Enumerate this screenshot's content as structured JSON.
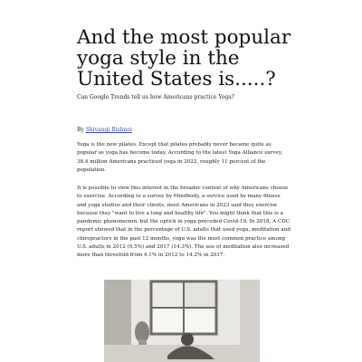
{
  "article": {
    "title": "And the most popular yoga style in the United States is.....?",
    "subtitle": "Can Google Trends tell us how Americans practice Yoga?",
    "byline_prefix": "By ",
    "author": "Shivangi Bishnoi",
    "paragraphs": [
      "Yoga is the new pilates. Except that pilates probably never became quite as popular as yoga has become today. According to the latest Yoga Alliance survey, 38.4 million Americans practiced yoga in 2022, roughly 11 percent of the population.",
      "It is possible to view this interest in the broader context of why Americans choose to exercise. According to a survey by Mindbody, a service used by many fitness and yoga studios and their clients, most Americans in 2023 said they exercise because they \"want to live a long and healthy life\". You might think that this is a pandemic phenomenon, but the uptick in yoga preceded Covid-19. In 2018, A CDC report showed that in the percentage of U.S. adults that used yoga, meditation and chiropractors in the past 12 months, yoga was the most common practice among U.S. adults in 2012 (9.5%) and 2017 (14.3%). The use of meditation also increased more than threefold from 4.1% in 2012 to 14.2% in 2017."
    ]
  }
}
